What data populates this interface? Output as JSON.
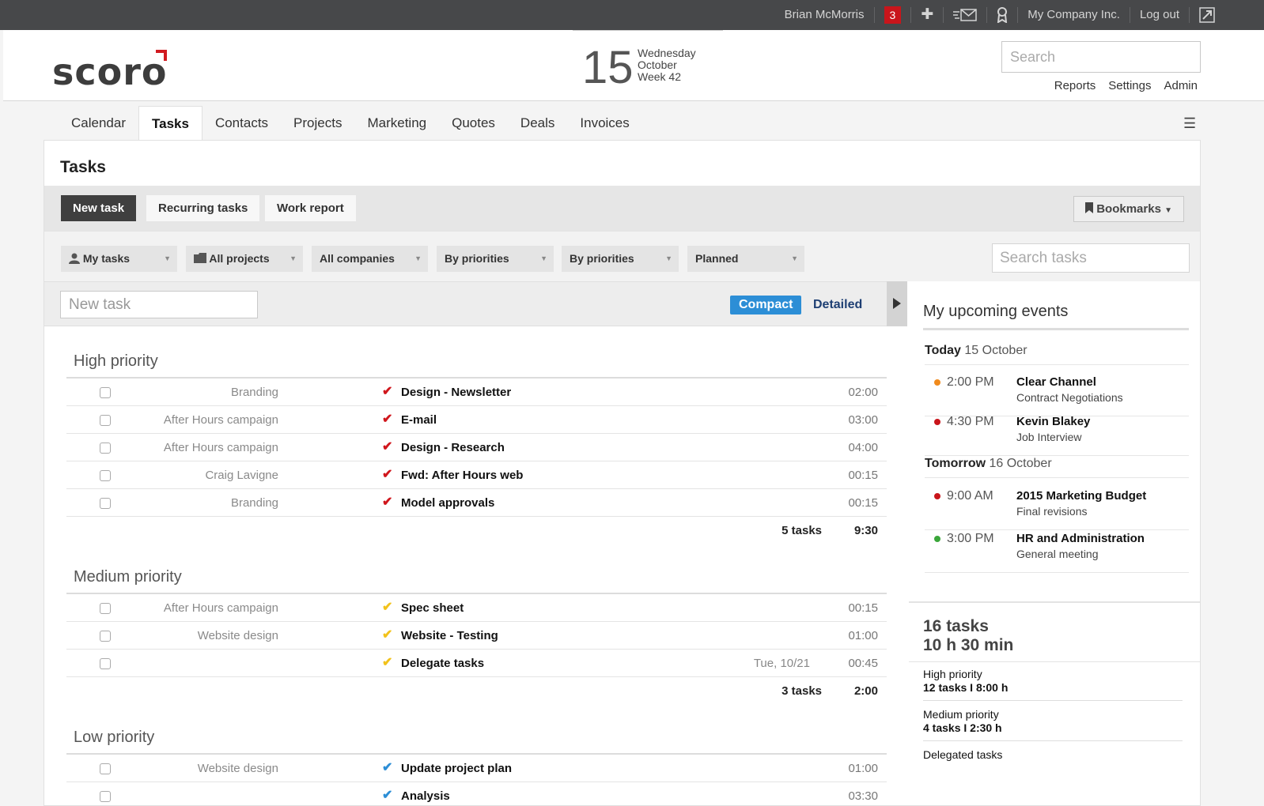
{
  "topbar": {
    "user": "Brian McMorris",
    "notifications": "3",
    "company": "My Company Inc.",
    "logout": "Log out"
  },
  "header": {
    "logo": "scoro",
    "date_day": "15",
    "date_weekday": "Wednesday",
    "date_month": "October",
    "date_week": "Week 42",
    "search_placeholder": "Search",
    "links": [
      "Reports",
      "Settings",
      "Admin"
    ]
  },
  "nav": [
    "Calendar",
    "Tasks",
    "Contacts",
    "Projects",
    "Marketing",
    "Quotes",
    "Deals",
    "Invoices"
  ],
  "page": {
    "title": "Tasks",
    "actions": {
      "new_task": "New task",
      "recurring": "Recurring tasks",
      "work_report": "Work report",
      "bookmarks": "Bookmarks"
    },
    "filters": [
      "My tasks",
      "All projects",
      "All companies",
      "By priorities",
      "By priorities",
      "Planned"
    ],
    "search_tasks_placeholder": "Search tasks",
    "new_task_placeholder": "New task",
    "view_compact": "Compact",
    "view_detailed": "Detailed"
  },
  "groups": [
    {
      "title": "High priority",
      "color": "#d0161c",
      "rows": [
        {
          "project": "Branding",
          "name": "Design - Newsletter",
          "due": "",
          "time": "02:00"
        },
        {
          "project": "After Hours campaign",
          "name": "E-mail",
          "due": "",
          "time": "03:00"
        },
        {
          "project": "After Hours campaign",
          "name": "Design - Research",
          "due": "",
          "time": "04:00"
        },
        {
          "project": "Craig Lavigne",
          "name": "Fwd: After Hours web",
          "due": "",
          "time": "00:15"
        },
        {
          "project": "Branding",
          "name": "Model approvals",
          "due": "",
          "time": "00:15"
        }
      ],
      "count": "5 tasks",
      "total": "9:30"
    },
    {
      "title": "Medium priority",
      "color": "#f2c21b",
      "rows": [
        {
          "project": "After Hours campaign",
          "name": "Spec sheet",
          "due": "",
          "time": "00:15"
        },
        {
          "project": "Website design",
          "name": "Website - Testing",
          "due": "",
          "time": "01:00"
        },
        {
          "project": "",
          "name": "Delegate tasks",
          "due": "Tue, 10/21",
          "time": "00:45"
        }
      ],
      "count": "3 tasks",
      "total": "2:00"
    },
    {
      "title": "Low priority",
      "color": "#2c8ed6",
      "rows": [
        {
          "project": "Website design",
          "name": "Update project plan",
          "due": "",
          "time": "01:00"
        },
        {
          "project": "",
          "name": "Analysis",
          "due": "",
          "time": "03:30"
        }
      ],
      "count": "",
      "total": ""
    }
  ],
  "upcoming": {
    "title": "My upcoming events",
    "today_label": "Today",
    "today_date": "15 October",
    "tomorrow_label": "Tomorrow",
    "tomorrow_date": "16 October",
    "events": [
      {
        "time": "2:00 PM",
        "title": "Clear Channel",
        "sub": "Contract Negotiations",
        "color": "#f08a1c"
      },
      {
        "time": "4:30 PM",
        "title": "Kevin Blakey",
        "sub": "Job Interview",
        "color": "#c9151b"
      },
      {
        "time": "9:00 AM",
        "title": "2015 Marketing Budget",
        "sub": "Final revisions",
        "color": "#c9151b"
      },
      {
        "time": "3:00 PM",
        "title": "HR and Administration",
        "sub": "General meeting",
        "color": "#3aa63a"
      }
    ]
  },
  "stats": {
    "tasks": "16 tasks",
    "duration": "10 h 30 min",
    "high_label": "High priority",
    "high_value": "12 tasks I 8:00 h",
    "medium_label": "Medium priority",
    "medium_value": "4 tasks I 2:30 h",
    "delegated": "Delegated tasks"
  }
}
